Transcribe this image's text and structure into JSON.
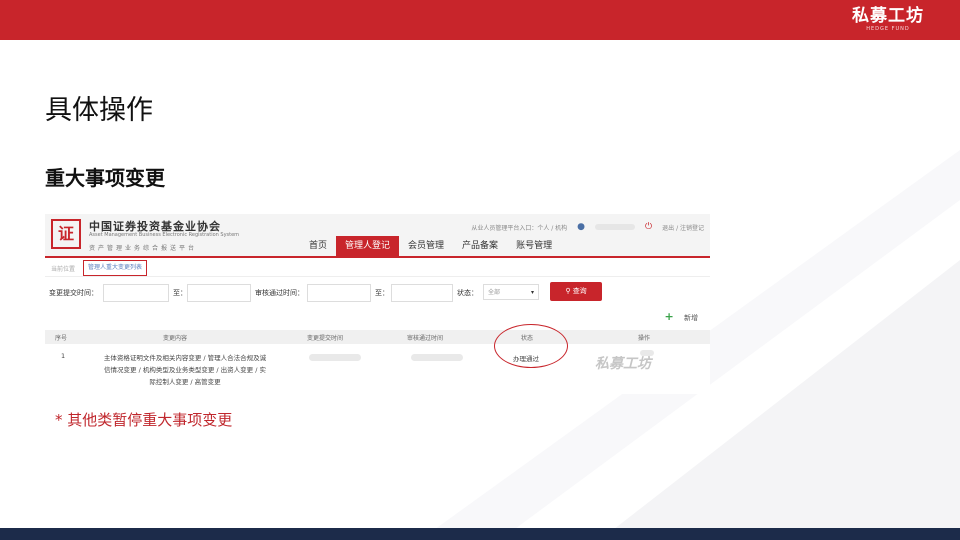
{
  "brand": {
    "name": "私募工坊",
    "sub": "HEDGE FUND"
  },
  "slide": {
    "title": "具体操作",
    "subtitle": "重大事项变更",
    "footnote": "* 其他类暂停重大事项变更"
  },
  "site": {
    "logo_glyph": "证",
    "org_name": "中国证券投资基金业协会",
    "org_en": "Asset Management Business Electronic Registration System",
    "org_sub": "资产管理业务综合报送平台",
    "top_links": {
      "entry": "从业人员管理平台入口：个人 / 机构",
      "logout": "退出 / 注销登记"
    },
    "icons": {
      "user": "person-icon",
      "power": "power-icon",
      "add": "plus-icon",
      "search": "search-icon"
    },
    "nav": [
      {
        "label": "首页"
      },
      {
        "label": "管理人登记",
        "active": true
      },
      {
        "label": "会员管理"
      },
      {
        "label": "产品备案"
      },
      {
        "label": "账号管理"
      }
    ],
    "breadcrumb": {
      "home": "当前位置",
      "current": "管理人重大变更列表"
    },
    "filters": {
      "submit_time_label": "变更提交时间：",
      "to1": "至：",
      "approve_time_label": "审核通过时间：",
      "to2": "至：",
      "status_label": "状态：",
      "status_value": "全部",
      "search_label": "查询"
    },
    "add_label": "新增",
    "table": {
      "headers": [
        "序号",
        "变更内容",
        "变更提交时间",
        "审核通过时间",
        "状态",
        "操作"
      ],
      "rows": [
        {
          "index": "1",
          "content_lines": [
            "主体资格证明文件及相关内容变更 / 管理人合法合规及诚",
            "信情况变更 / 机构类型及业务类型变更 / 出资人变更 / 实",
            "际控制人变更 / 高管变更"
          ],
          "status": "办理通过"
        }
      ]
    },
    "watermark": "私募工坊"
  },
  "colors": {
    "accent": "#c8252b",
    "footer": "#1c2b4a",
    "link": "#5a7fbf"
  }
}
